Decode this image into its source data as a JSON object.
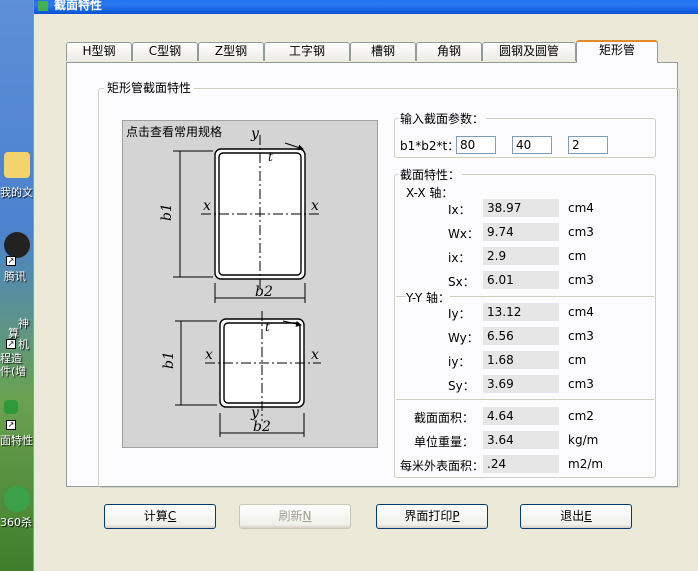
{
  "window": {
    "title": "截面特性"
  },
  "desktop": {
    "labels": [
      "我的文",
      "腾讯",
      "神",
      "算",
      "机",
      "程造",
      "件(增",
      "面特性",
      "360杀"
    ]
  },
  "tabs": [
    {
      "label": "H型钢",
      "active": false
    },
    {
      "label": "C型钢",
      "active": false
    },
    {
      "label": "Z型钢",
      "active": false
    },
    {
      "label": "工字钢",
      "active": false
    },
    {
      "label": "槽钢",
      "active": false
    },
    {
      "label": "角钢",
      "active": false
    },
    {
      "label": "圆钢及圆管",
      "active": false
    },
    {
      "label": "矩形管",
      "active": true
    }
  ],
  "section": {
    "group_title": "矩形管截面特性",
    "diagram_link": "点击查看常用规格",
    "diagram_labels": {
      "y": "y",
      "x": "x",
      "t": "t",
      "b1": "b1",
      "b2": "b2"
    }
  },
  "input_group": {
    "title": "输入截面参数：",
    "label": "b1*b2*t：",
    "b1": "80",
    "b2": "40",
    "t": "2"
  },
  "props": {
    "title": "截面特性：",
    "xx_axis": "X-X 轴：",
    "yy_axis": "Y-Y 轴：",
    "xx": [
      {
        "label": "Ix：",
        "value": "38.97",
        "unit": "cm4"
      },
      {
        "label": "Wx：",
        "value": "9.74",
        "unit": "cm3"
      },
      {
        "label": "ix：",
        "value": "2.9",
        "unit": "cm"
      },
      {
        "label": "Sx：",
        "value": "6.01",
        "unit": "cm3"
      }
    ],
    "yy": [
      {
        "label": "Iy：",
        "value": "13.12",
        "unit": "cm4"
      },
      {
        "label": "Wy：",
        "value": "6.56",
        "unit": "cm3"
      },
      {
        "label": "iy：",
        "value": "1.68",
        "unit": "cm"
      },
      {
        "label": "Sy：",
        "value": "3.69",
        "unit": "cm3"
      }
    ],
    "other": [
      {
        "label": "截面面积：",
        "value": "4.64",
        "unit": "cm2"
      },
      {
        "label": "单位重量：",
        "value": "3.64",
        "unit": "kg/m"
      },
      {
        "label": "每米外表面积：",
        "value": ".24",
        "unit": "m2/m"
      }
    ]
  },
  "buttons": {
    "calc": "计算",
    "calc_key": "C",
    "refresh": "刷新",
    "refresh_key": "N",
    "print": "界面打印",
    "print_key": "P",
    "exit": "退出",
    "exit_key": "E"
  }
}
